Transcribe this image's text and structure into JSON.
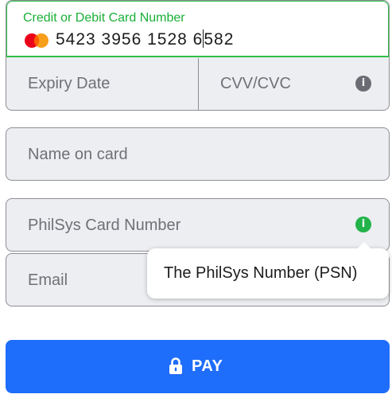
{
  "card_number": {
    "label": "Credit or Debit Card Number",
    "value_before_caret": "5423 3956 1528 6",
    "value_after_caret": "582",
    "brand_icon": "mastercard-logo-icon",
    "label_color": "#1aaf38"
  },
  "expiry": {
    "placeholder": "Expiry Date"
  },
  "cvv": {
    "placeholder": "CVV/CVC",
    "info_icon": "info-icon",
    "info_glyph": "i"
  },
  "name": {
    "placeholder": "Name on card"
  },
  "philsys": {
    "placeholder": "PhilSys Card Number",
    "info_icon": "info-icon",
    "info_glyph": "i",
    "info_color": "#22b34a"
  },
  "email": {
    "placeholder": "Email"
  },
  "tooltip": {
    "text": "The PhilSys Number (PSN)"
  },
  "pay_button": {
    "label": "PAY",
    "icon": "lock-icon",
    "color": "#1f6dfb"
  }
}
